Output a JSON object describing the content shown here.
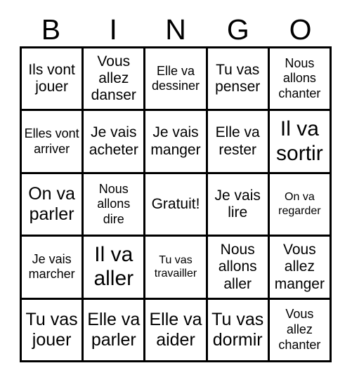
{
  "card": {
    "title_letters": [
      "B",
      "I",
      "N",
      "G",
      "O"
    ],
    "colors": {
      "background": "#ffffff",
      "border": "#000000",
      "text": "#000000"
    },
    "grid": {
      "rows": 5,
      "columns": 5,
      "cells": [
        [
          {
            "text": "Ils vont jouer",
            "size": "md"
          },
          {
            "text": "Vous allez danser",
            "size": "md"
          },
          {
            "text": "Elle va dessiner",
            "size": "sm"
          },
          {
            "text": "Tu vas penser",
            "size": "md"
          },
          {
            "text": "Nous allons chanter",
            "size": "sm"
          }
        ],
        [
          {
            "text": "Elles vont arriver",
            "size": "sm"
          },
          {
            "text": "Je vais acheter",
            "size": "md"
          },
          {
            "text": "Je vais manger",
            "size": "md"
          },
          {
            "text": "Elle va rester",
            "size": "md"
          },
          {
            "text": "Il va sortir",
            "size": "xl"
          }
        ],
        [
          {
            "text": "On va parler",
            "size": "lg"
          },
          {
            "text": "Nous allons dire",
            "size": "sm"
          },
          {
            "text": "Gratuit!",
            "size": "md"
          },
          {
            "text": "Je vais lire",
            "size": "md"
          },
          {
            "text": "On va regarder",
            "size": "xs"
          }
        ],
        [
          {
            "text": "Je vais marcher",
            "size": "sm"
          },
          {
            "text": "Il va aller",
            "size": "xl"
          },
          {
            "text": "Tu vas travailler",
            "size": "xs"
          },
          {
            "text": "Nous allons aller",
            "size": "md"
          },
          {
            "text": "Vous allez manger",
            "size": "md"
          }
        ],
        [
          {
            "text": "Tu vas jouer",
            "size": "lg"
          },
          {
            "text": "Elle va parler",
            "size": "lg"
          },
          {
            "text": "Elle va aider",
            "size": "lg"
          },
          {
            "text": "Tu vas dormir",
            "size": "lg"
          },
          {
            "text": "Vous allez chanter",
            "size": "sm"
          }
        ]
      ]
    }
  }
}
